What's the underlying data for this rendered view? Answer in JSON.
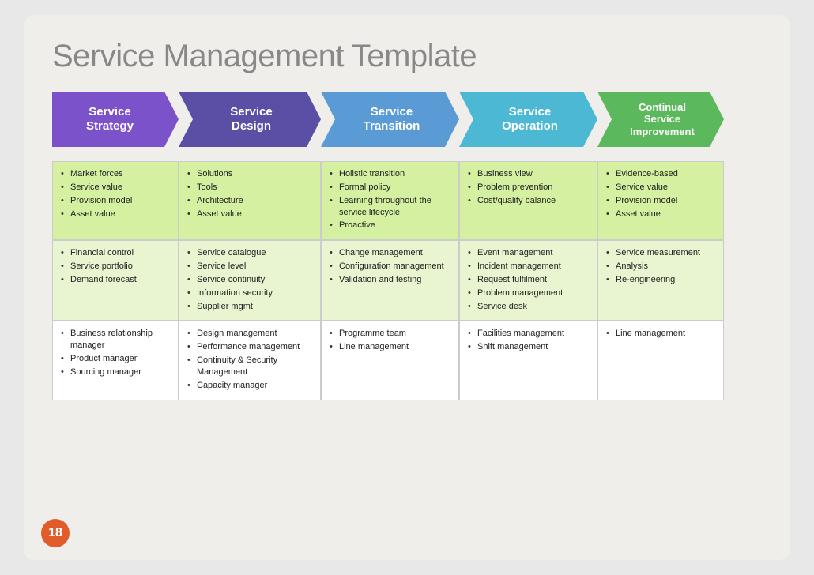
{
  "title": "Service Management Template",
  "headers": [
    {
      "id": "col1",
      "label": "Service\nStrategy",
      "color": "#7b52c9",
      "class": "col1-arrow"
    },
    {
      "id": "col2",
      "label": "Service\nDesign",
      "color": "#5b4ea5",
      "class": "col2-arrow"
    },
    {
      "id": "col3",
      "label": "Service\nTransition",
      "color": "#5b9bd5",
      "class": "col3-arrow"
    },
    {
      "id": "col4",
      "label": "Service\nOperation",
      "color": "#4db8d4",
      "class": "col4-arrow"
    },
    {
      "id": "col5",
      "label": "Continual\nService\nImprovement",
      "color": "#5cb85c",
      "class": "col5-arrow"
    }
  ],
  "rows": [
    {
      "cells": [
        [
          "Market forces",
          "Service value",
          "Provision model",
          "Asset value"
        ],
        [
          "Solutions",
          "Tools",
          "Architecture",
          "Asset value"
        ],
        [
          "Holistic transition",
          "Formal policy",
          "Learning throughout the service lifecycle",
          "Proactive"
        ],
        [
          "Business view",
          "Problem prevention",
          "Cost/quality balance"
        ],
        [
          "Evidence-based",
          "Service value",
          "Provision model",
          "Asset value"
        ]
      ]
    },
    {
      "cells": [
        [
          "Financial control",
          "Service portfolio",
          "Demand forecast"
        ],
        [
          "Service catalogue",
          "Service level",
          "Service continuity",
          "Information security",
          "Supplier mgmt"
        ],
        [
          "Change management",
          "Configuration management",
          "Validation and testing"
        ],
        [
          "Event management",
          "Incident management",
          "Request fulfilment",
          "Problem management",
          "Service desk"
        ],
        [
          "Service measurement",
          "Analysis",
          "Re-engineering"
        ]
      ]
    },
    {
      "cells": [
        [
          "Business relationship manager",
          "Product manager",
          "Sourcing manager"
        ],
        [
          "Design management",
          "Performance management",
          "Continuity & Security Management",
          "Capacity manager"
        ],
        [
          "Programme team",
          "Line management"
        ],
        [
          "Facilities management",
          "Shift management"
        ],
        [
          "Line management"
        ]
      ]
    }
  ],
  "page_number": "18"
}
